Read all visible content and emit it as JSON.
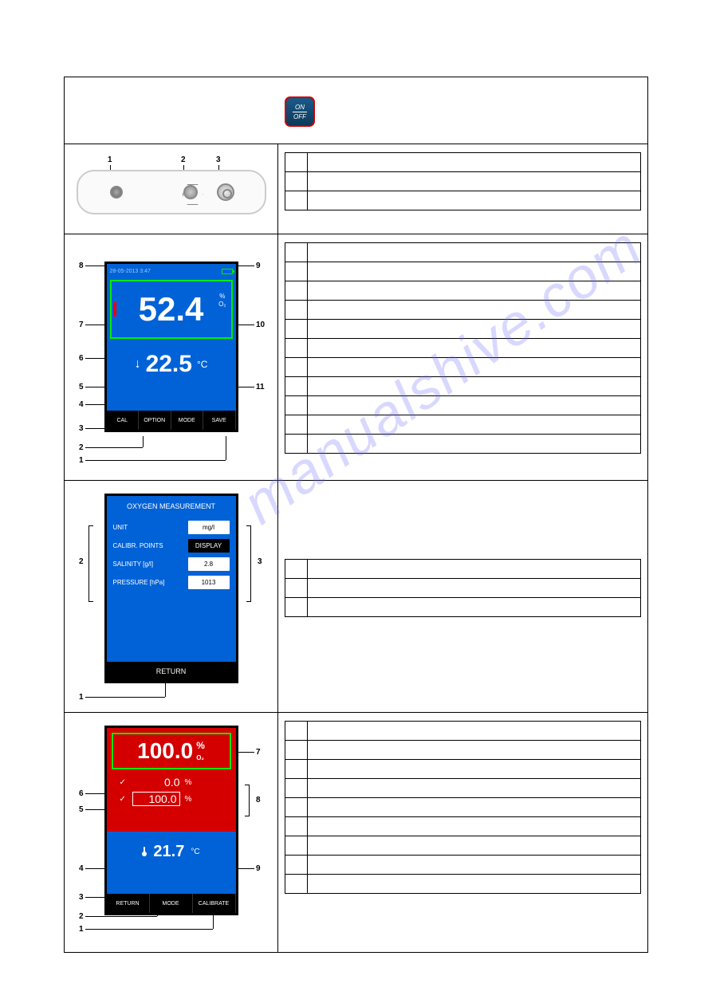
{
  "watermark": "manualshive.com",
  "onoff": {
    "top": "ON",
    "bottom": "OFF"
  },
  "connectors": {
    "callouts": [
      "1",
      "2",
      "3"
    ],
    "table_rows": 3
  },
  "screenA": {
    "datetime": "28-05-2013  3:47",
    "value": "52.4",
    "unit_top": "%",
    "unit_bottom": "O₂",
    "temp_arrow": "↓",
    "temp_value": "22.5",
    "temp_unit": "°C",
    "buttons": [
      "CAL",
      "OPTION",
      "MODE",
      "SAVE"
    ],
    "left_callouts": [
      "8",
      "7",
      "6",
      "5",
      "4",
      "3",
      "2",
      "1"
    ],
    "right_callouts": [
      "9",
      "10",
      "11"
    ],
    "table_rows": 11
  },
  "screenB": {
    "title": "OXYGEN MEASUREMENT",
    "rows": [
      {
        "label": "UNIT",
        "value": "mg/l",
        "dark": false
      },
      {
        "label": "CALIBR. POINTS",
        "value": "DISPLAY",
        "dark": true
      },
      {
        "label": "SALINITY  [g/l]",
        "value": "2.8",
        "dark": false
      },
      {
        "label": "PRESSURE  [hPa]",
        "value": "1013",
        "dark": false
      }
    ],
    "bottom": "RETURN",
    "left_callout_2": "2",
    "right_callout_3": "3",
    "bottom_callout_1": "1",
    "table_rows": 3
  },
  "screenC": {
    "main_value": "100.0",
    "main_unit": "%",
    "main_sub": "O₂",
    "cal_rows": [
      {
        "check": "✓",
        "value": "0.0",
        "unit": "%",
        "boxed": false
      },
      {
        "check": "✓",
        "value": "100.0",
        "unit": "%",
        "boxed": true
      }
    ],
    "temp_value": "21.7",
    "temp_unit": "°C",
    "buttons": [
      "RETURN",
      "MODE",
      "CALIBRATE"
    ],
    "left_callouts": [
      "6",
      "5",
      "4",
      "3",
      "2",
      "1"
    ],
    "right_callouts": [
      "7",
      "8",
      "9"
    ],
    "table_rows": 9
  }
}
